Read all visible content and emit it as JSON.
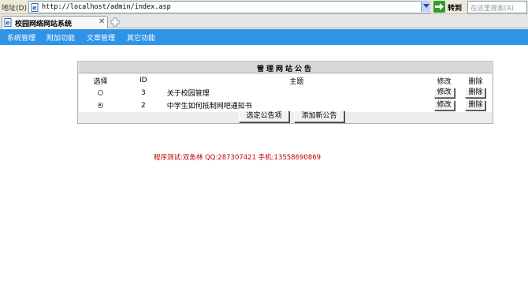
{
  "address_bar": {
    "label": "地址(D)",
    "url": "http://localhost/admin/index.asp",
    "go_label": "转到",
    "search_placeholder": "在这里搜索(A)"
  },
  "tab": {
    "title": "校园网络网站系统",
    "close": "✕"
  },
  "menu": {
    "items": [
      {
        "label": "系统管理"
      },
      {
        "label": "附加功能"
      },
      {
        "label": "文章管理"
      },
      {
        "label": "其它功能"
      }
    ]
  },
  "panel": {
    "title": "管理网站公告",
    "headers": {
      "select": "选择",
      "id": "ID",
      "subject": "主题",
      "edit": "修改",
      "delete": "删除"
    },
    "rows": [
      {
        "id": "3",
        "subject": "关于校园管理",
        "selected": false,
        "edit": "修改",
        "delete": "删除"
      },
      {
        "id": "2",
        "subject": "中学生如何抵制网吧通知书",
        "selected": true,
        "edit": "修改",
        "delete": "删除"
      }
    ],
    "buttons": {
      "select_item": "选定公告项",
      "add_new": "添加新公告"
    }
  },
  "footer": {
    "note": "程序测试:双鱼林 QQ:287307421 手机:13558690869"
  },
  "colors": {
    "menubar": "#2f94e7",
    "footer_text": "#c00000",
    "go_icon": "#2e9e2e"
  }
}
